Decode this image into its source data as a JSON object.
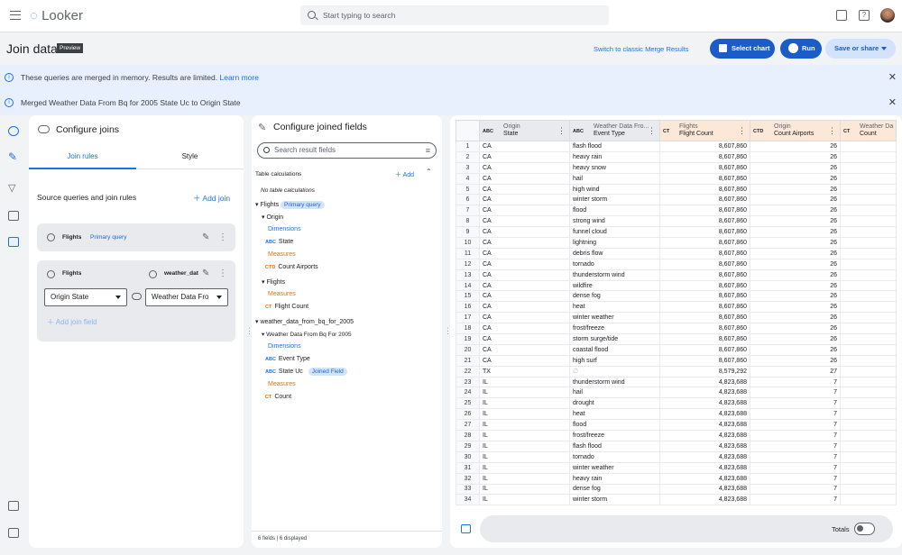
{
  "app": {
    "logo": "Looker"
  },
  "search": {
    "placeholder": "Start typing to search"
  },
  "header": {
    "title": "Join data",
    "badge": "Preview",
    "switch_link": "Switch to classic Merge Results",
    "select_chart": "Select chart",
    "run": "Run",
    "save_share": "Save or share"
  },
  "banners": [
    {
      "text": "These queries are merged in memory. Results are limited.",
      "link": "Learn more"
    },
    {
      "text": "Merged Weather Data From Bq for 2005 State Uc to Origin State"
    }
  ],
  "joins": {
    "title": "Configure joins",
    "tabs": [
      "Join rules",
      "Style"
    ],
    "section": "Source queries and join rules",
    "add_join": "Add join",
    "primary_query": "Flights",
    "primary_chip": "Primary query",
    "second_query": "Flights",
    "second_source": "weather_dat",
    "left_field": "Origin State",
    "right_field": "Weather Data Fro",
    "add_join_field": "Add join field"
  },
  "fields": {
    "title": "Configure joined fields",
    "search_placeholder": "Search result fields",
    "table_calc": "Table calculations",
    "add": "Add",
    "no_calc": "No table calculations",
    "flights": "Flights",
    "primary_chip": "Primary query",
    "origin": "Origin",
    "dimensions": "Dimensions",
    "measures": "Measures",
    "state": "State",
    "count_airports": "Count Airports",
    "flights_group": "Flights",
    "flight_count": "Flight Count",
    "weather_source": "weather_data_from_bq_for_2005",
    "weather_view": "Weather Data From Bq For 2005",
    "event_type": "Event Type",
    "state_uc": "State Uc",
    "joined_chip": "Joined Field",
    "count": "Count",
    "footer": "6 fields | 6 displayed"
  },
  "grid": {
    "columns": [
      {
        "tag": "ABC",
        "l1": "Origin",
        "l2": "State",
        "kind": "dim"
      },
      {
        "tag": "ABC",
        "l1": "Weather Data Fro...",
        "l2": "Event Type",
        "kind": "dim"
      },
      {
        "tag": "CT",
        "l1": "Flights",
        "l2": "Flight Count",
        "kind": "mea"
      },
      {
        "tag": "CTD",
        "l1": "Origin",
        "l2": "Count Airports",
        "kind": "mea"
      },
      {
        "tag": "CT",
        "l1": "Weather Da",
        "l2": "Count",
        "kind": "mea"
      }
    ],
    "rows": [
      [
        "1",
        "CA",
        "flash flood",
        "8,607,860",
        "26",
        ""
      ],
      [
        "2",
        "CA",
        "heavy rain",
        "8,607,860",
        "26",
        ""
      ],
      [
        "3",
        "CA",
        "heavy snow",
        "8,607,860",
        "26",
        ""
      ],
      [
        "4",
        "CA",
        "hail",
        "8,607,860",
        "26",
        ""
      ],
      [
        "5",
        "CA",
        "high wind",
        "8,607,860",
        "26",
        ""
      ],
      [
        "6",
        "CA",
        "winter storm",
        "8,607,860",
        "26",
        ""
      ],
      [
        "7",
        "CA",
        "flood",
        "8,607,860",
        "26",
        ""
      ],
      [
        "8",
        "CA",
        "strong wind",
        "8,607,860",
        "26",
        ""
      ],
      [
        "9",
        "CA",
        "funnel cloud",
        "8,607,860",
        "26",
        ""
      ],
      [
        "10",
        "CA",
        "lightning",
        "8,607,860",
        "26",
        ""
      ],
      [
        "11",
        "CA",
        "debris flow",
        "8,607,860",
        "26",
        ""
      ],
      [
        "12",
        "CA",
        "tornado",
        "8,607,860",
        "26",
        ""
      ],
      [
        "13",
        "CA",
        "thunderstorm wind",
        "8,607,860",
        "26",
        ""
      ],
      [
        "14",
        "CA",
        "wildfire",
        "8,607,860",
        "26",
        ""
      ],
      [
        "15",
        "CA",
        "dense fog",
        "8,607,860",
        "26",
        ""
      ],
      [
        "16",
        "CA",
        "heat",
        "8,607,860",
        "26",
        ""
      ],
      [
        "17",
        "CA",
        "winter weather",
        "8,607,860",
        "26",
        ""
      ],
      [
        "18",
        "CA",
        "frost/freeze",
        "8,607,860",
        "26",
        ""
      ],
      [
        "19",
        "CA",
        "storm surge/tide",
        "8,607,860",
        "26",
        ""
      ],
      [
        "20",
        "CA",
        "coastal flood",
        "8,607,860",
        "26",
        ""
      ],
      [
        "21",
        "CA",
        "high surf",
        "8,607,860",
        "26",
        ""
      ],
      [
        "22",
        "TX",
        "∅",
        "8,579,292",
        "27",
        ""
      ],
      [
        "23",
        "IL",
        "thunderstorm wind",
        "4,823,688",
        "7",
        ""
      ],
      [
        "24",
        "IL",
        "hail",
        "4,823,688",
        "7",
        ""
      ],
      [
        "25",
        "IL",
        "drought",
        "4,823,688",
        "7",
        ""
      ],
      [
        "26",
        "IL",
        "heat",
        "4,823,688",
        "7",
        ""
      ],
      [
        "27",
        "IL",
        "flood",
        "4,823,688",
        "7",
        ""
      ],
      [
        "28",
        "IL",
        "frost/freeze",
        "4,823,688",
        "7",
        ""
      ],
      [
        "29",
        "IL",
        "flash flood",
        "4,823,688",
        "7",
        ""
      ],
      [
        "30",
        "IL",
        "tornado",
        "4,823,688",
        "7",
        ""
      ],
      [
        "31",
        "IL",
        "winter weather",
        "4,823,688",
        "7",
        ""
      ],
      [
        "32",
        "IL",
        "heavy rain",
        "4,823,688",
        "7",
        ""
      ],
      [
        "33",
        "IL",
        "dense fog",
        "4,823,688",
        "7",
        ""
      ],
      [
        "34",
        "IL",
        "winter storm",
        "4,823,688",
        "7",
        ""
      ]
    ],
    "totals": "Totals"
  }
}
